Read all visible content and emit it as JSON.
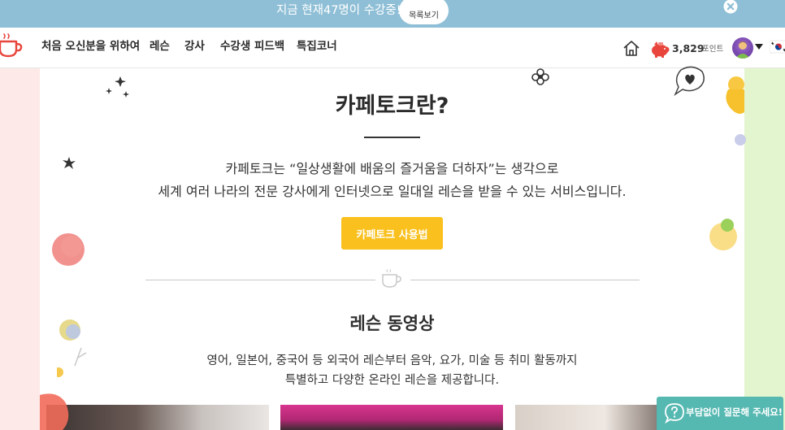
{
  "topbar": {
    "message": "지금 현재47명이 수강중!",
    "list_button_label": "목록보기",
    "close_icon": "close-circle-icon"
  },
  "nav": {
    "logo_icon": "cafetalk-cup-logo",
    "items": [
      {
        "label": "처음 오신분을 위하여"
      },
      {
        "label": "레슨"
      },
      {
        "label": "강사"
      },
      {
        "label": "수강생 피드백"
      },
      {
        "label": "특집코너"
      }
    ],
    "home_icon": "home-icon",
    "points_icon": "piggy-bank-icon",
    "points_value": "3,829",
    "points_unit": "포인트",
    "language_flag": "korea-flag-icon",
    "brand_color": "#e8453c"
  },
  "about": {
    "title": "카페토크란?",
    "description_lines": [
      "카페토크는 “일상생활에 배움의 즐거움을 더하자”는 생각으로",
      "세계 여러 나라의 전문 강사에게 인터넷으로 일대일 레슨을 받을 수 있는 서비스입니다."
    ],
    "guide_button_label": "카페토크 사용법",
    "guide_button_color": "#f9c01e"
  },
  "lesson_videos": {
    "title": "레슨 동영상",
    "description_lines": [
      "영어, 일본어, 중국어 등 외국어 레슨부터 음악, 요가, 미술 등 취미 활동까지",
      "특별하고 다양한 온라인 레슨을 제공합니다."
    ]
  },
  "help_button": {
    "label": "부담없이 질문해 주세요!",
    "color": "#55b8b1"
  },
  "colors": {
    "topbar_bg": "#8fbfd6",
    "left_bg": "#fde9e7",
    "right_bg": "#e3f5cf"
  }
}
